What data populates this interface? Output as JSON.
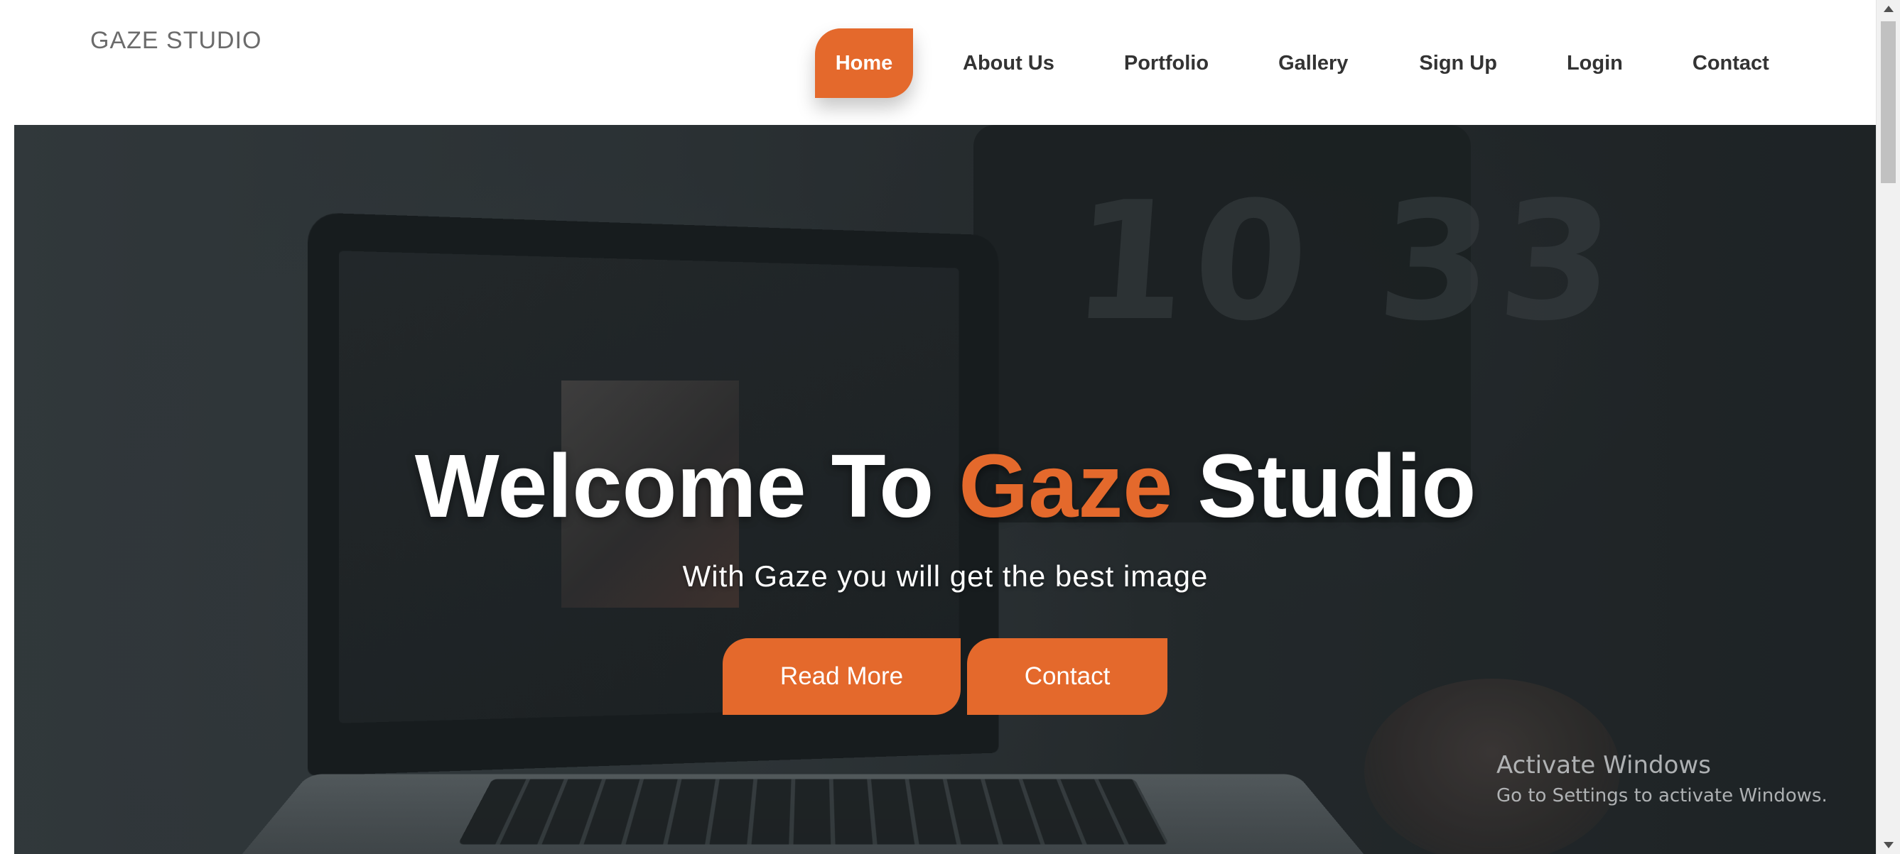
{
  "header": {
    "logo": "GAZE STUDIO",
    "nav": [
      {
        "label": "Home",
        "active": true
      },
      {
        "label": "About Us",
        "active": false
      },
      {
        "label": "Portfolio",
        "active": false
      },
      {
        "label": "Gallery",
        "active": false
      },
      {
        "label": "Sign Up",
        "active": false
      },
      {
        "label": "Login",
        "active": false
      },
      {
        "label": "Contact",
        "active": false
      }
    ]
  },
  "hero": {
    "title_before": "Welcome To",
    "title_accent": "Gaze",
    "title_after": "Studio",
    "subtitle": "With Gaze you will get the best image",
    "buttons": {
      "read_more": "Read More",
      "contact": "Contact"
    },
    "background_clock_text": "10 33"
  },
  "watermark": {
    "title": "Activate Windows",
    "subtitle": "Go to Settings to activate Windows."
  },
  "colors": {
    "accent": "#e4692c",
    "nav_text": "#333333",
    "logo_text": "#6b6b6b",
    "hero_text": "#ffffff"
  },
  "icons": [
    "scroll-up-arrow-icon",
    "scroll-down-arrow-icon"
  ]
}
